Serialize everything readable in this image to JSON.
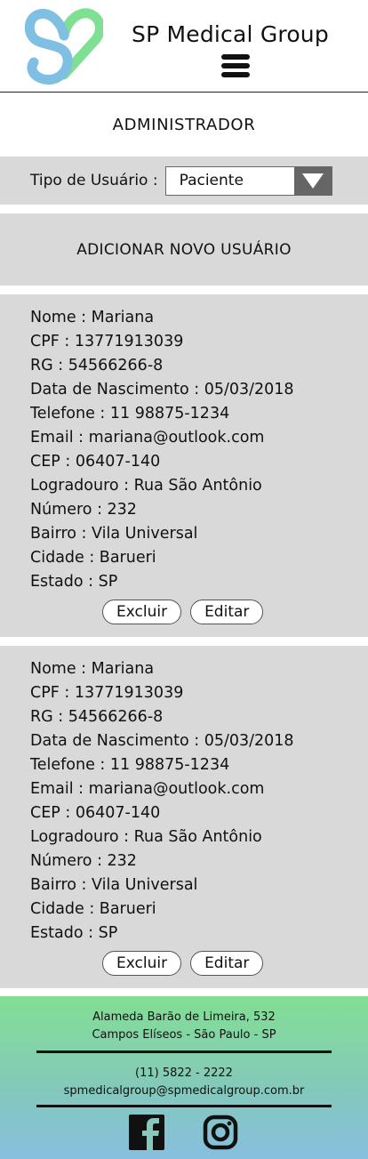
{
  "header": {
    "brand": "SP Medical Group"
  },
  "page_title": "ADMINISTRADOR",
  "user_type": {
    "label": "Tipo de Usuário :",
    "selected": "Paciente"
  },
  "add_button": "ADICIONAR NOVO USUÁRIO",
  "users": [
    {
      "lines": [
        "Nome : Mariana",
        "CPF : 13771913039",
        "RG : 54566266-8",
        "Data de Nascimento : 05/03/2018",
        "Telefone : 11 98875-1234",
        "Email : mariana@outlook.com",
        "CEP : 06407-140",
        "Logradouro : Rua São Antônio",
        "Número : 232",
        "Bairro : Vila Universal",
        "Cidade : Barueri",
        "Estado : SP"
      ],
      "delete_label": "Excluir",
      "edit_label": "Editar"
    },
    {
      "lines": [
        "Nome : Mariana",
        "CPF : 13771913039",
        "RG : 54566266-8",
        "Data de Nascimento : 05/03/2018",
        "Telefone : 11 98875-1234",
        "Email : mariana@outlook.com",
        "CEP : 06407-140",
        "Logradouro : Rua São Antônio",
        "Número : 232",
        "Bairro : Vila Universal",
        "Cidade : Barueri",
        "Estado : SP"
      ],
      "delete_label": "Excluir",
      "edit_label": "Editar"
    }
  ],
  "footer": {
    "address_line1": "Alameda Barão de Limeira, 532",
    "address_line2": "Campos Elíseos - São Paulo - SP",
    "phone": "(11) 5822 - 2222",
    "email": "spmedicalgroup@spmedicalgroup.com.br"
  },
  "icons": [
    "logo-icon",
    "hamburger-menu-icon",
    "dropdown-arrow-icon",
    "facebook-icon",
    "instagram-icon"
  ],
  "colors": {
    "panel": "#d9d9d9",
    "logo_blue": "#7ebfe3",
    "logo_green": "#7ee093",
    "footer_top": "#82df93",
    "footer_bottom": "#87bfe0"
  }
}
